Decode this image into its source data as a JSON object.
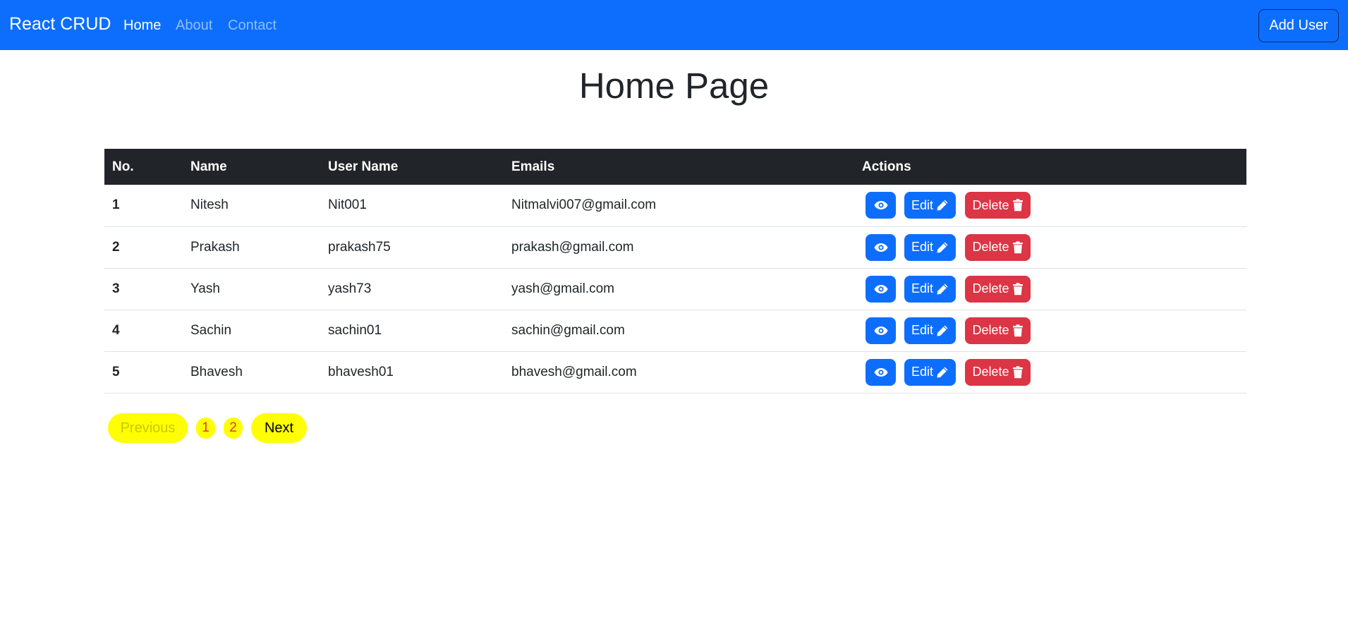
{
  "navbar": {
    "brand": "React CRUD",
    "links": [
      {
        "label": "Home",
        "active": true
      },
      {
        "label": "About",
        "active": false
      },
      {
        "label": "Contact",
        "active": false
      }
    ],
    "add_user_label": "Add User"
  },
  "page": {
    "title": "Home Page"
  },
  "table": {
    "headers": [
      "No.",
      "Name",
      "User Name",
      "Emails",
      "Actions"
    ],
    "rows": [
      {
        "no": "1",
        "name": "Nitesh",
        "username": "Nit001",
        "email": "Nitmalvi007@gmail.com"
      },
      {
        "no": "2",
        "name": "Prakash",
        "username": "prakash75",
        "email": "prakash@gmail.com"
      },
      {
        "no": "3",
        "name": "Yash",
        "username": "yash73",
        "email": "yash@gmail.com"
      },
      {
        "no": "4",
        "name": "Sachin",
        "username": "sachin01",
        "email": "sachin@gmail.com"
      },
      {
        "no": "5",
        "name": "Bhavesh",
        "username": "bhavesh01",
        "email": "bhavesh@gmail.com"
      }
    ],
    "actions": {
      "view_icon": "eye-icon",
      "edit_label": "Edit",
      "edit_icon": "pencil-icon",
      "delete_label": "Delete",
      "delete_icon": "trash-icon"
    }
  },
  "pagination": {
    "previous_label": "Previous",
    "pages": [
      "1",
      "2"
    ],
    "next_label": "Next"
  },
  "colors": {
    "navbar": "#0d6efd",
    "table_header": "#212529",
    "primary_button": "#0d6efd",
    "danger_button": "#dc3545",
    "pagination_bg": "#ffff00"
  }
}
